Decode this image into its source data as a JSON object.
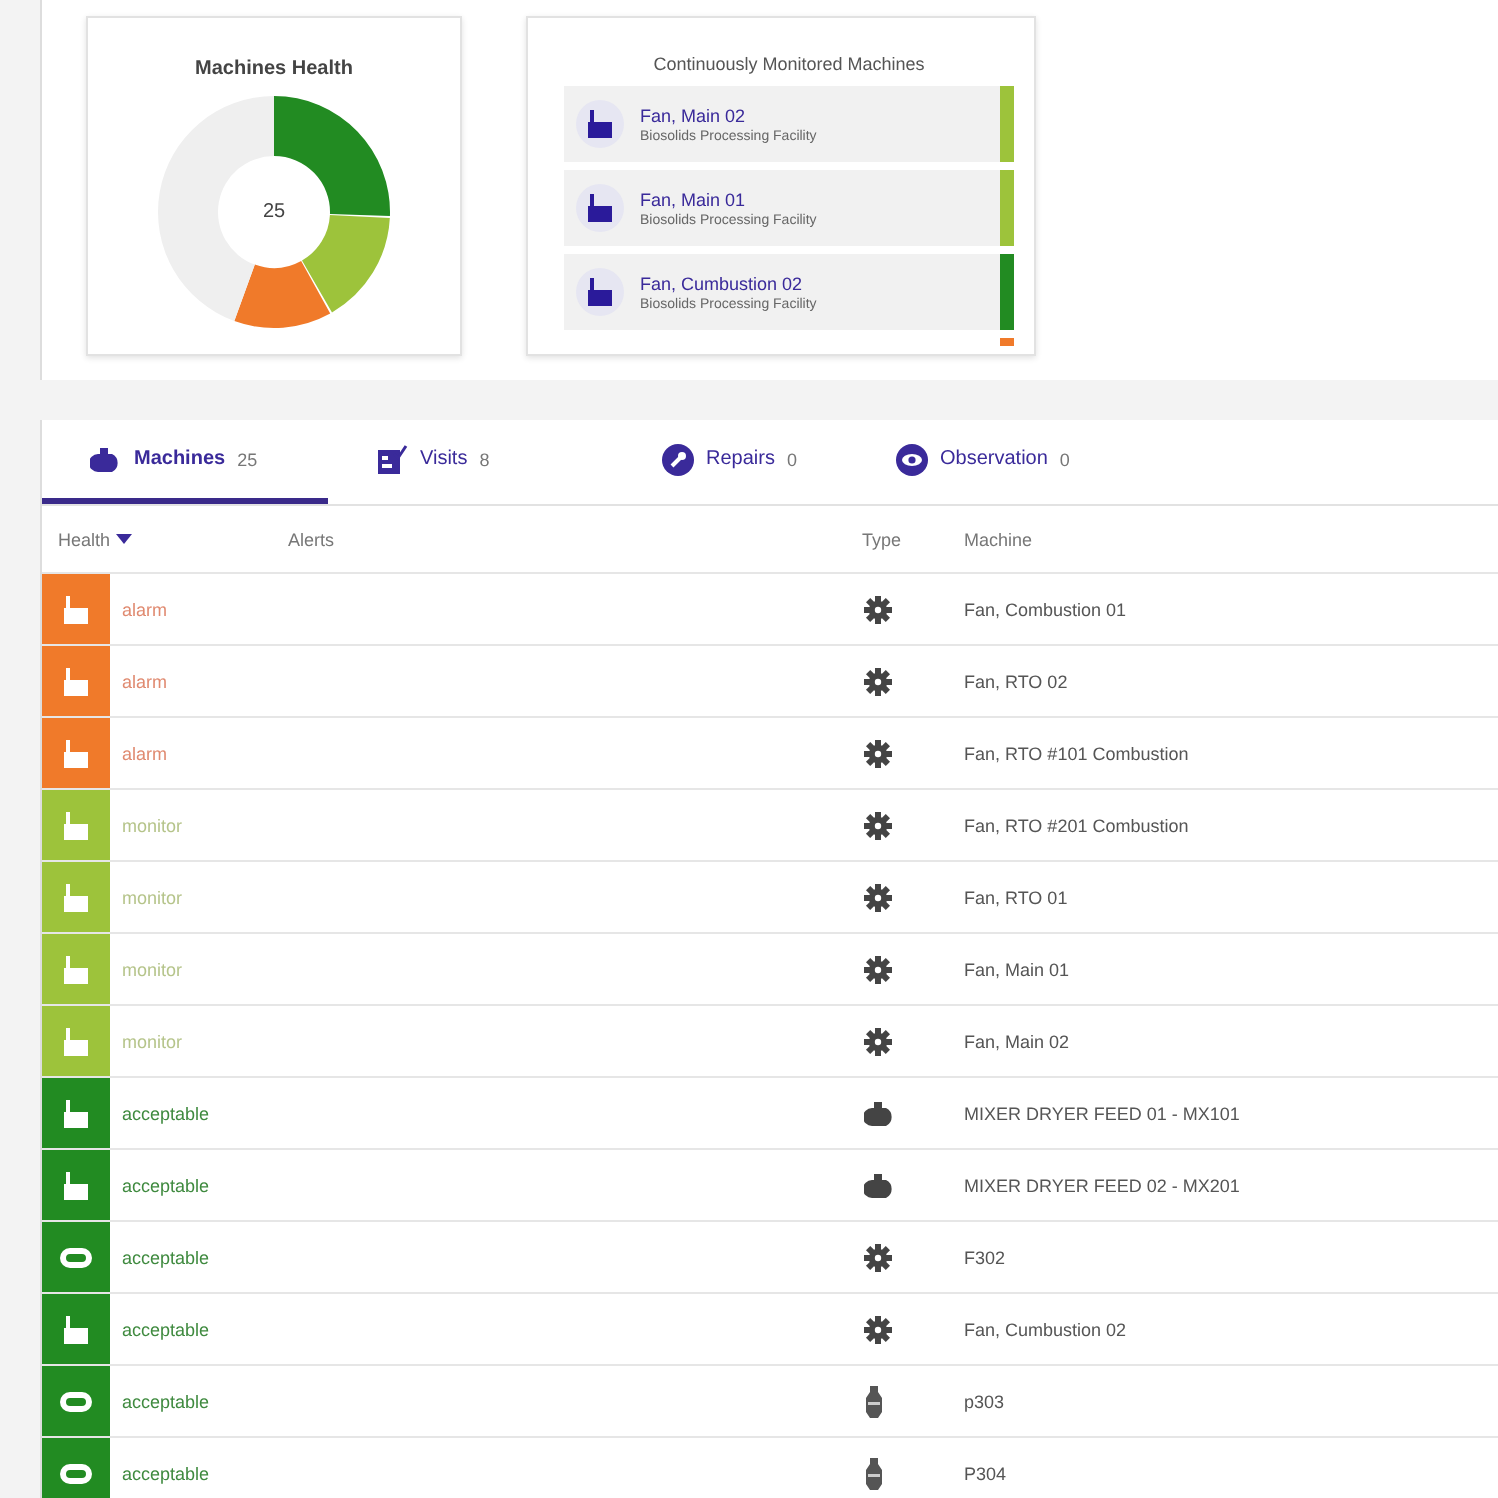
{
  "health_card": {
    "title": "Machines Health",
    "total": "25"
  },
  "monitored_card": {
    "title": "Continuously Monitored Machines",
    "items": [
      {
        "name": "Fan, Main 02",
        "site": "Biosolids Processing Facility",
        "color": "#9dc33b"
      },
      {
        "name": "Fan, Main 01",
        "site": "Biosolids Processing Facility",
        "color": "#9dc33b"
      },
      {
        "name": "Fan, Cumbustion 02",
        "site": "Biosolids Processing Facility",
        "color": "#228b22"
      }
    ]
  },
  "tabs": [
    {
      "kind": "machines",
      "label": "Machines",
      "count": "25",
      "selected": true
    },
    {
      "kind": "visits",
      "label": "Visits",
      "count": "8",
      "selected": false
    },
    {
      "kind": "repairs",
      "label": "Repairs",
      "count": "0",
      "selected": false
    },
    {
      "kind": "observation",
      "label": "Observation",
      "count": "0",
      "selected": false
    }
  ],
  "table": {
    "columns": [
      "Health",
      "Alerts",
      "Type",
      "Machine"
    ],
    "rows": [
      {
        "kind": "alarm",
        "status": "alarm",
        "machine": "Fan, Combustion 01"
      },
      {
        "kind": "alarm",
        "status": "alarm",
        "machine": "Fan, RTO 02"
      },
      {
        "kind": "alarm",
        "status": "alarm",
        "machine": "Fan, RTO #101 Combustion"
      },
      {
        "kind": "monitor",
        "status": "monitor",
        "machine": "Fan, RTO #201 Combustion"
      },
      {
        "kind": "monitor",
        "status": "monitor",
        "machine": "Fan, RTO 01"
      },
      {
        "kind": "monitor",
        "status": "monitor",
        "machine": "Fan, Main 01"
      },
      {
        "kind": "monitor",
        "status": "monitor",
        "machine": "Fan, Main 02"
      },
      {
        "kind": "acceptable",
        "status": "acceptable",
        "machine": "MIXER DRYER FEED 01 - MX101"
      },
      {
        "kind": "acceptable",
        "status": "acceptable",
        "machine": "MIXER DRYER FEED 02 - MX201"
      },
      {
        "kind": "acceptable",
        "status": "acceptable",
        "machine": "F302"
      },
      {
        "kind": "acceptable",
        "status": "acceptable",
        "machine": "Fan, Cumbustion 02"
      },
      {
        "kind": "acceptable",
        "status": "acceptable",
        "machine": "p303"
      },
      {
        "kind": "acceptable",
        "status": "acceptable",
        "machine": "P304"
      }
    ]
  }
}
